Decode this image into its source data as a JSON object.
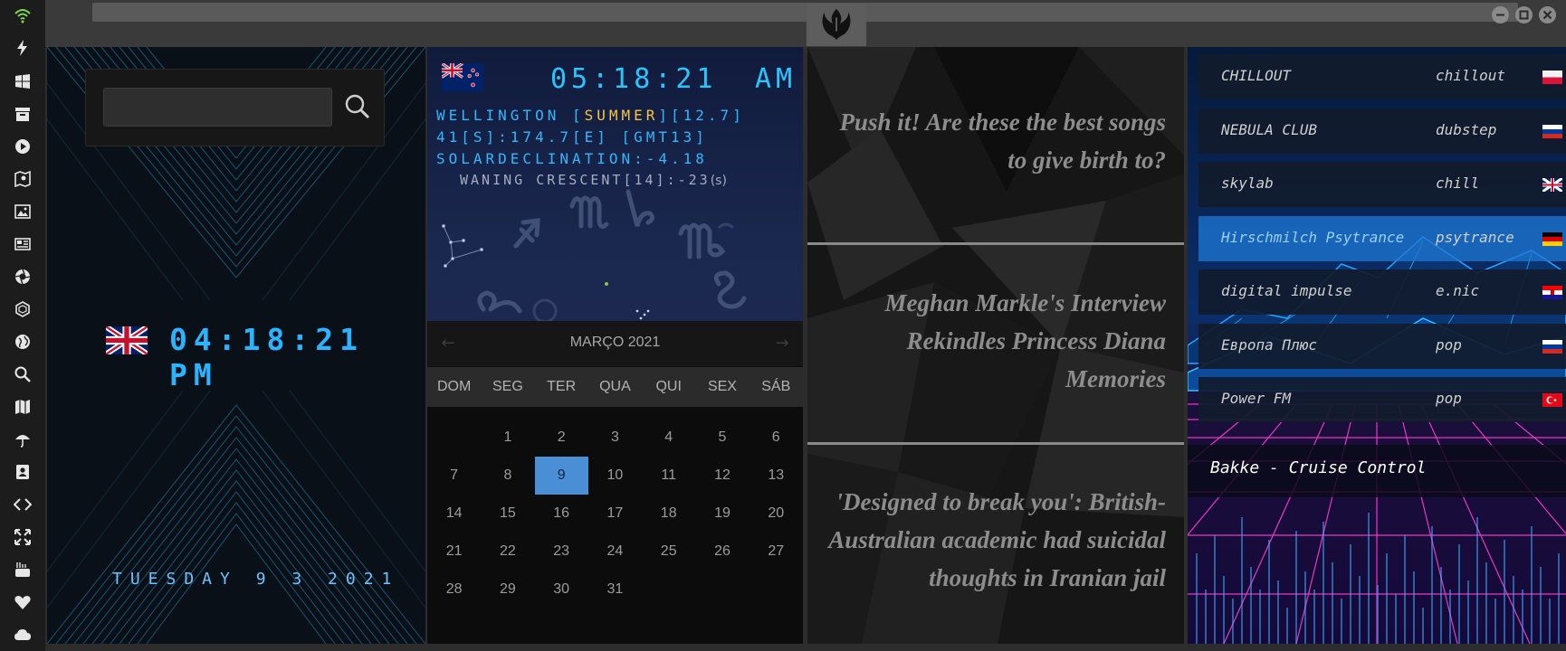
{
  "sidebar": {
    "icons": [
      "wifi-icon",
      "bolt-icon",
      "windows-icon",
      "archive-icon",
      "play-icon",
      "map-photo-icon",
      "image-icon",
      "news-icon",
      "aperture-icon",
      "hexagon-icon",
      "globe-icon",
      "search-icon",
      "map-icon",
      "umbrella-icon",
      "contacts-icon",
      "code-icon",
      "fullscreen-icon",
      "youtube-icon",
      "heart-icon",
      "cloud-icon"
    ],
    "wifi_color": "#7bd94a"
  },
  "titlebar": {
    "logo": "rebel-alliance-logo"
  },
  "clock_panel": {
    "search": {
      "value": "",
      "placeholder": ""
    },
    "time": "04:18:21 PM",
    "date": "TUESDAY 9 3 2021",
    "flag": "uk-flag"
  },
  "world_clock": {
    "flag": "new-zealand-flag",
    "time": "05:18:21",
    "ampm": "AM",
    "line1_prefix": "WELLINGTON [",
    "line1_season": "SUMMER",
    "line1_suffix": "][12.7]",
    "line2": "41[S]:174.7[E] [GMT13]",
    "line3": "SOLARDECLINATION:-4.18",
    "moon": "WANING CRESCENT[14]:-23",
    "moon_unit": "(s)"
  },
  "calendar": {
    "title": "MARÇO 2021",
    "prev": "←",
    "next": "→",
    "weekdays": [
      "DOM",
      "SEG",
      "TER",
      "QUA",
      "QUI",
      "SEX",
      "SÁB"
    ],
    "weeks": [
      [
        "",
        "1",
        "2",
        "3",
        "4",
        "5",
        "6"
      ],
      [
        "7",
        "8",
        "9",
        "10",
        "11",
        "12",
        "13"
      ],
      [
        "14",
        "15",
        "16",
        "17",
        "18",
        "19",
        "20"
      ],
      [
        "21",
        "22",
        "23",
        "24",
        "25",
        "26",
        "27"
      ],
      [
        "28",
        "29",
        "30",
        "31",
        "",
        "",
        ""
      ]
    ],
    "today": "9"
  },
  "news": [
    "Push it! Are these the best songs to give birth to?",
    "Meghan Markle's Interview Rekindles Princess Diana Memories",
    "'Designed to break you': British-Australian academic had suicidal thoughts in Iranian jail"
  ],
  "radio": {
    "stations": [
      {
        "name": "CHILLOUT",
        "genre": "chillout",
        "flag": "poland-flag"
      },
      {
        "name": "NEBULA CLUB",
        "genre": "dubstep",
        "flag": "russia-flag"
      },
      {
        "name": "skylab",
        "genre": "chill",
        "flag": "uk-flag"
      },
      {
        "name": "Hirschmilch Psytrance",
        "genre": "psytrance",
        "flag": "germany-flag"
      },
      {
        "name": "digital impulse",
        "genre": "e.nic",
        "flag": "croatia-flag"
      },
      {
        "name": "Европа Плюс",
        "genre": "pop",
        "flag": "russia-flag"
      },
      {
        "name": "Power FM",
        "genre": "pop",
        "flag": "turkey-flag"
      }
    ],
    "active_index": 3,
    "now_playing": "Bakke - Cruise Control"
  }
}
